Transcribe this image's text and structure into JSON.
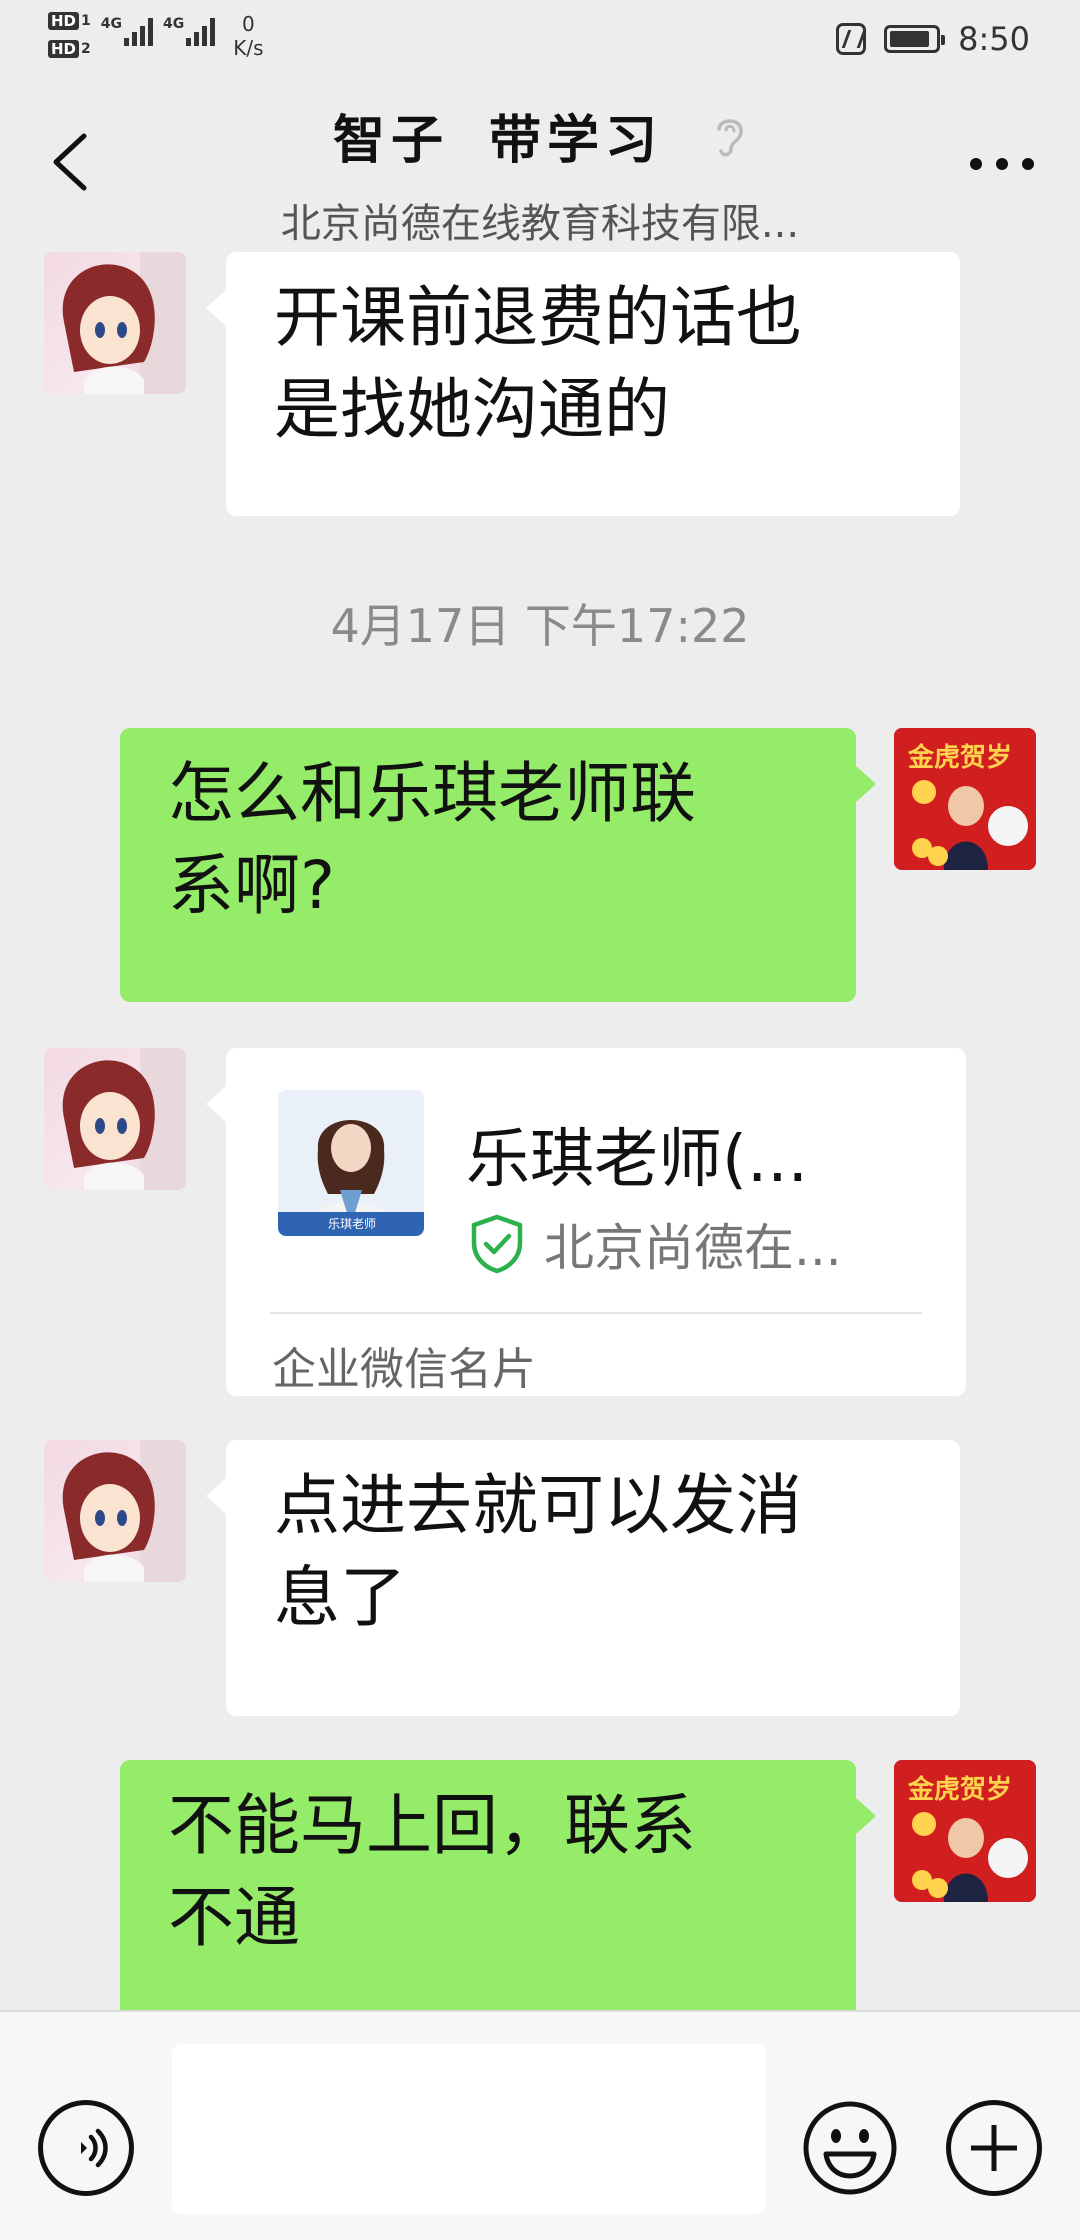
{
  "status_bar": {
    "sim1_label": "HD",
    "sim1_num": "1",
    "sim2_label": "HD",
    "sim2_num": "2",
    "network1": "4G",
    "network2": "4G",
    "speed_value": "0",
    "speed_unit": "K/s",
    "time": "8:50"
  },
  "header": {
    "title_name": "智子",
    "title_suffix": "带学习",
    "subtitle": "北京尚德在线教育科技有限..."
  },
  "messages": {
    "m1_text_line1": "开课前退费的话也",
    "m1_text_line2": "是找她沟通的",
    "timestamp": "4月17日 下午17:22",
    "m2_text_line1": "怎么和乐琪老师联",
    "m2_text_line2": "系啊?",
    "card_name": "乐琪老师(...",
    "card_company": "北京尚德在...",
    "card_type": "企业微信名片",
    "card_photo_caption": "乐琪老师",
    "m4_text_line1": "点进去就可以发消",
    "m4_text_line2": "息了",
    "m5_text_line1": "不能马上回，联系",
    "m5_text_line2": "不通",
    "avatar_self_caption": "金虎贺岁"
  },
  "colors": {
    "chat_background": "#ededed",
    "outgoing_bubble": "#95ec69",
    "incoming_bubble": "#ffffff",
    "verified_green": "#2bb24c"
  }
}
